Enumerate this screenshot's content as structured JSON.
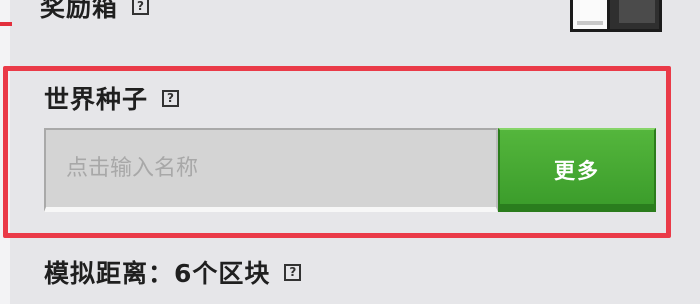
{
  "reward_box": {
    "label": "奖励箱",
    "help_icon": "help-icon",
    "toggle_state": "off"
  },
  "world_seed": {
    "label": "世界种子",
    "help_icon": "help-icon",
    "input_placeholder": "点击输入名称",
    "input_value": "",
    "more_button_label": "更多"
  },
  "simulation_distance": {
    "label": "模拟距离：6个区块",
    "help_icon": "help-icon"
  },
  "colors": {
    "background": "#e6e6e9",
    "highlight_border": "#ea3a48",
    "button_green": "#47a832",
    "button_text": "#ffffff"
  }
}
